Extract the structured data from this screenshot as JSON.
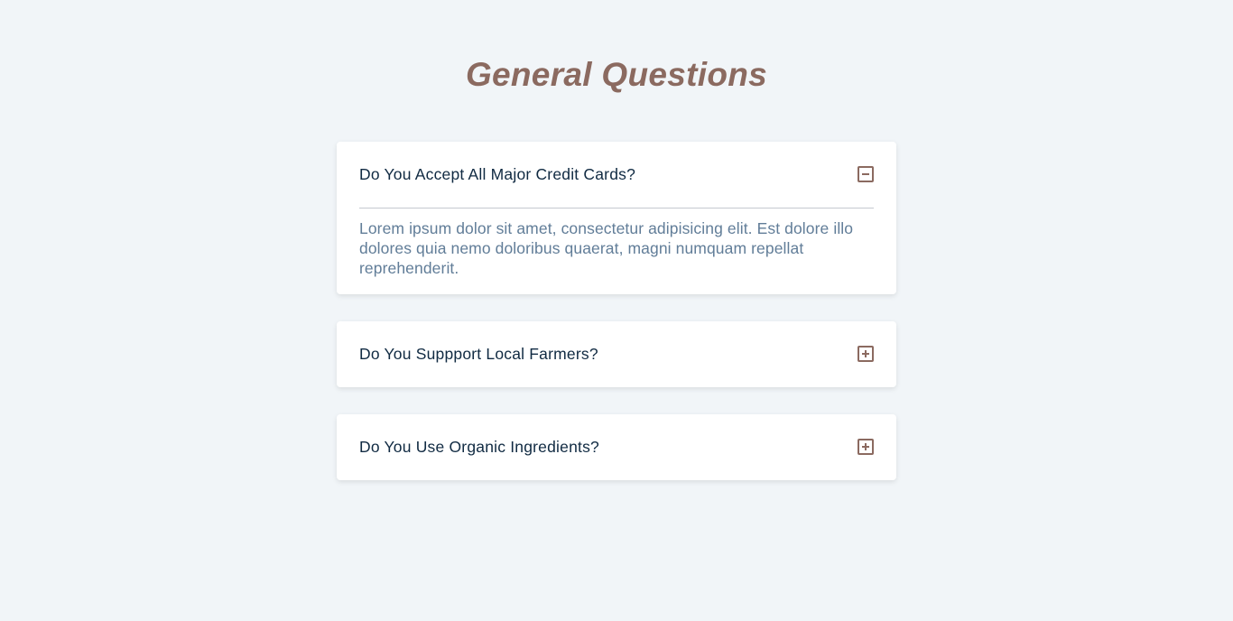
{
  "title": "General Questions",
  "questions": [
    {
      "question": "Do You Accept All Major Credit Cards?",
      "answer": "Lorem ipsum dolor sit amet, consectetur adipisicing elit. Est dolore illo dolores quia nemo doloribus quaerat, magni numquam repellat reprehenderit.",
      "expanded": true,
      "toggle_icon": "minus-square-icon"
    },
    {
      "question": "Do You Suppport Local Farmers?",
      "expanded": false,
      "toggle_icon": "plus-square-icon"
    },
    {
      "question": "Do You Use Organic Ingredients?",
      "expanded": false,
      "toggle_icon": "plus-square-icon"
    }
  ],
  "colors": {
    "background": "#f1f5f8",
    "accent": "#8b6a60",
    "question_text": "#102a42",
    "answer_text": "#617d98"
  }
}
